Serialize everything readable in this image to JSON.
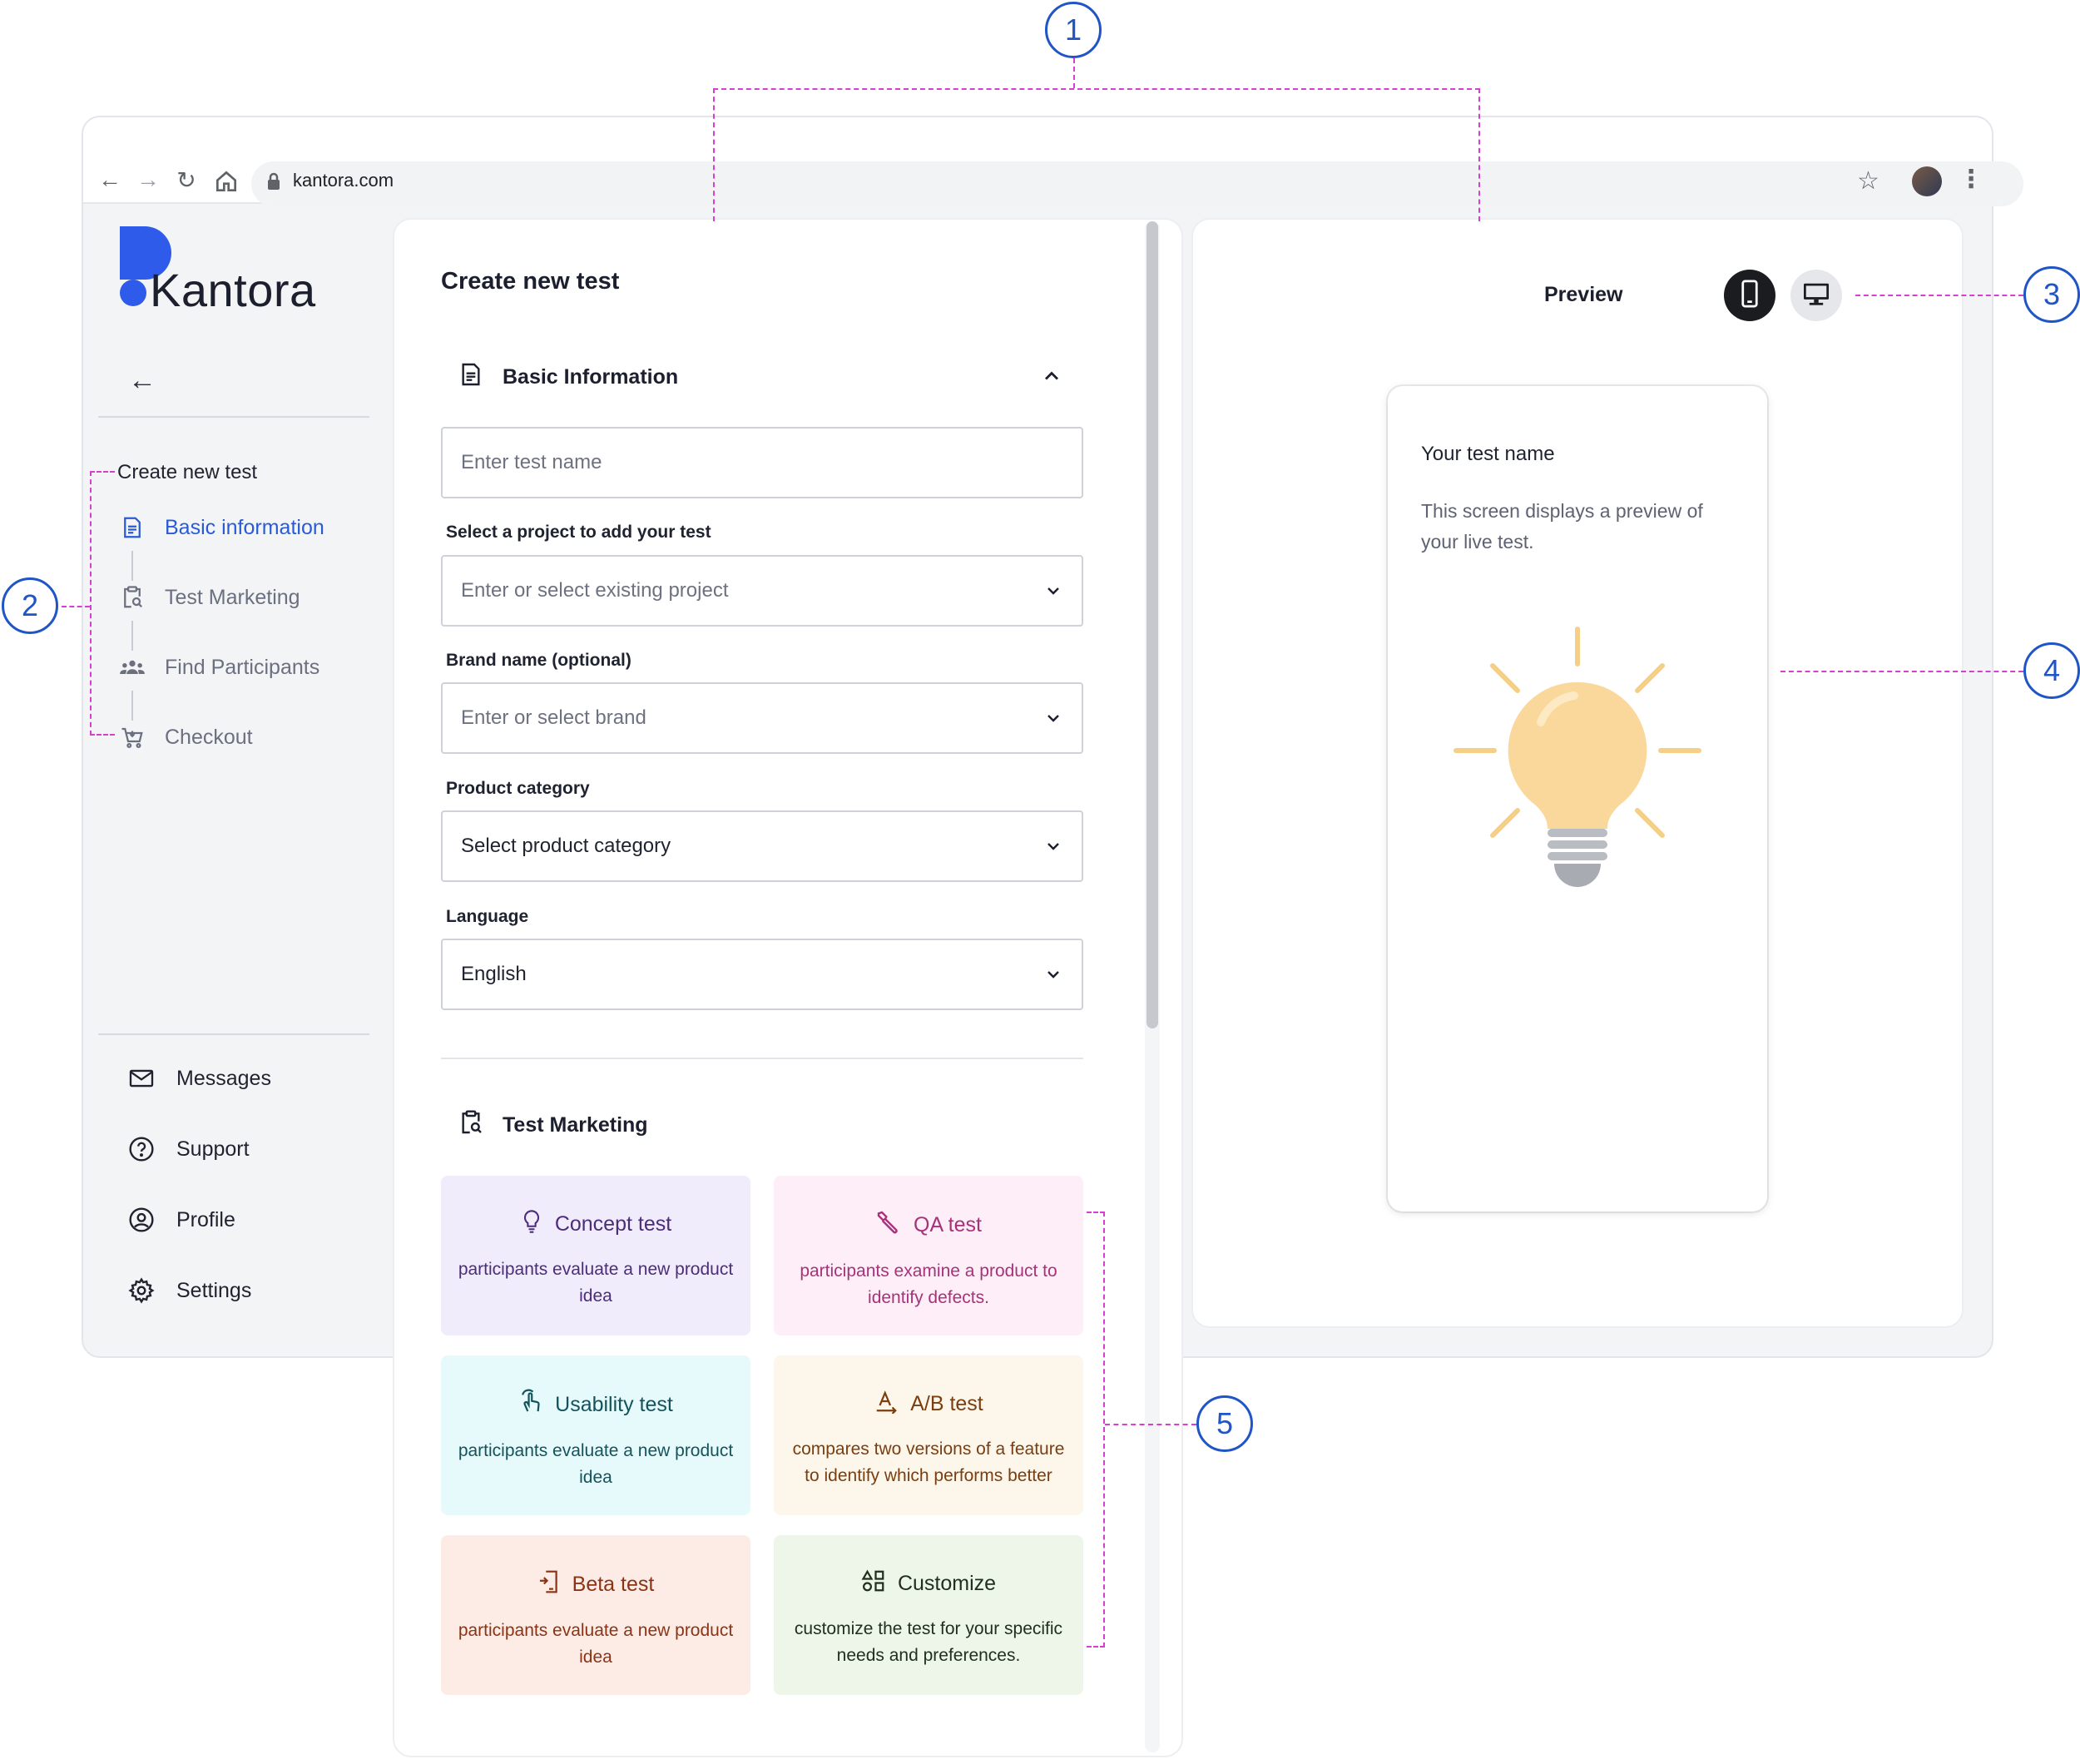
{
  "browser": {
    "url": "kantora.com"
  },
  "brand": {
    "name": "Kantora",
    "accent": "#2f5bea"
  },
  "sidebar": {
    "heading": "Create new test",
    "steps": [
      {
        "label": "Basic information",
        "icon": "document-icon",
        "active": true
      },
      {
        "label": "Test Marketing",
        "icon": "clipboard-search-icon",
        "active": false
      },
      {
        "label": "Find Participants",
        "icon": "people-icon",
        "active": false
      },
      {
        "label": "Checkout",
        "icon": "cart-icon",
        "active": false
      }
    ],
    "menu": [
      {
        "label": "Messages",
        "icon": "mail-icon"
      },
      {
        "label": "Support",
        "icon": "help-circle-icon"
      },
      {
        "label": "Profile",
        "icon": "user-circle-icon"
      },
      {
        "label": "Settings",
        "icon": "gear-icon"
      }
    ]
  },
  "form": {
    "title": "Create new test",
    "basic_section": "Basic Information",
    "test_name_placeholder": "Enter test name",
    "project_label": "Select a project to add your test",
    "project_placeholder": "Enter or select existing project",
    "brand_label": "Brand name (optional)",
    "brand_placeholder": "Enter or select brand",
    "category_label": "Product category",
    "category_value": "Select product category",
    "language_label": "Language",
    "language_value": "English",
    "marketing_section": "Test Marketing"
  },
  "test_types": [
    {
      "title": "Concept test",
      "desc": "participants evaluate a new product idea",
      "icon": "lightbulb-icon",
      "color": "#4b2d7a"
    },
    {
      "title": "QA test",
      "desc": "participants examine a product to identify defects.",
      "icon": "wrench-icon",
      "color": "#a8327a"
    },
    {
      "title": "Usability test",
      "desc": "participants evaluate a new product idea",
      "icon": "tap-gesture-icon",
      "color": "#14535b"
    },
    {
      "title": "A/B test",
      "desc": "compares two versions of a feature to identify which performs better",
      "icon": "ab-text-icon",
      "color": "#7a3e10"
    },
    {
      "title": "Beta test",
      "desc": "participants evaluate a new product idea",
      "icon": "beta-device-icon",
      "color": "#8a3415"
    },
    {
      "title": "Customize",
      "desc": "customize the test for your specific needs and preferences.",
      "icon": "shapes-icon",
      "color": "#21301c"
    }
  ],
  "preview": {
    "title": "Preview",
    "test_name": "Your test name",
    "description": "This screen displays a preview of your live test."
  },
  "callouts": [
    "1",
    "2",
    "3",
    "4",
    "5"
  ]
}
